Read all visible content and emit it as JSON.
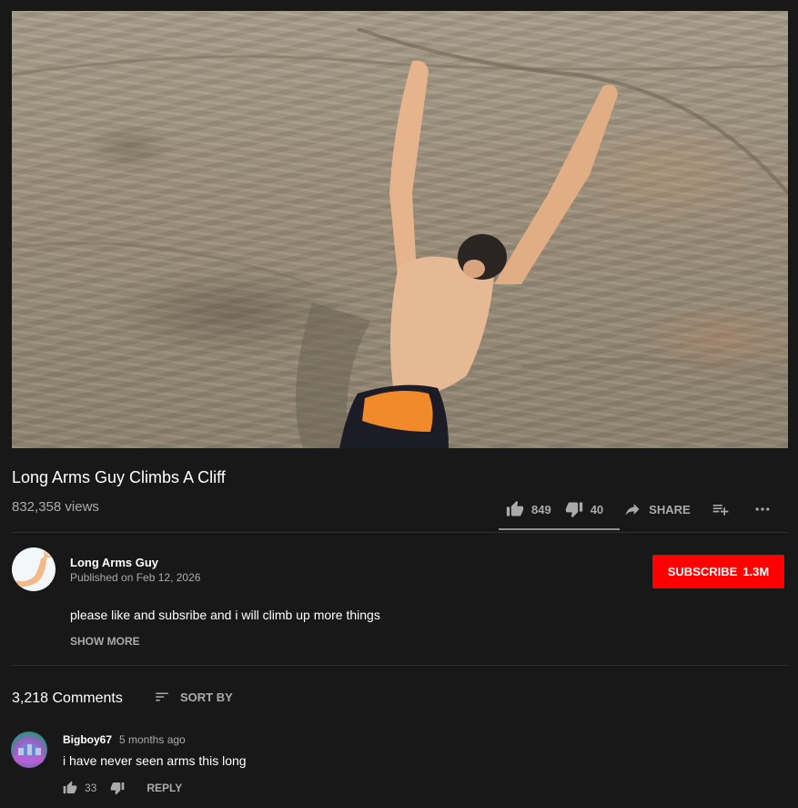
{
  "video": {
    "title": "Long Arms Guy Climbs A Cliff",
    "views": "832,358 views",
    "thumbnail_icon": "cliff-climber-image"
  },
  "actions": {
    "likes": "849",
    "dislikes": "40",
    "share_label": "SHARE",
    "like_ratio": 0.955
  },
  "channel": {
    "name": "Long Arms Guy",
    "published": "Published on Feb 12, 2026",
    "subscribe_label": "SUBSCRIBE",
    "subscriber_count": "1.3M",
    "description": "please like and subsribe and i will climb up more things",
    "show_more_label": "SHOW MORE"
  },
  "comments": {
    "count_label": "3,218 Comments",
    "sort_label": "SORT BY",
    "items": [
      {
        "author": "Bigboy67",
        "time": "5 months ago",
        "text": "i have never seen arms this long",
        "likes": "33",
        "reply_label": "REPLY"
      }
    ]
  },
  "colors": {
    "background": "#181818",
    "subscribe": "#ff0000",
    "secondary_text": "#aaaaaa"
  }
}
